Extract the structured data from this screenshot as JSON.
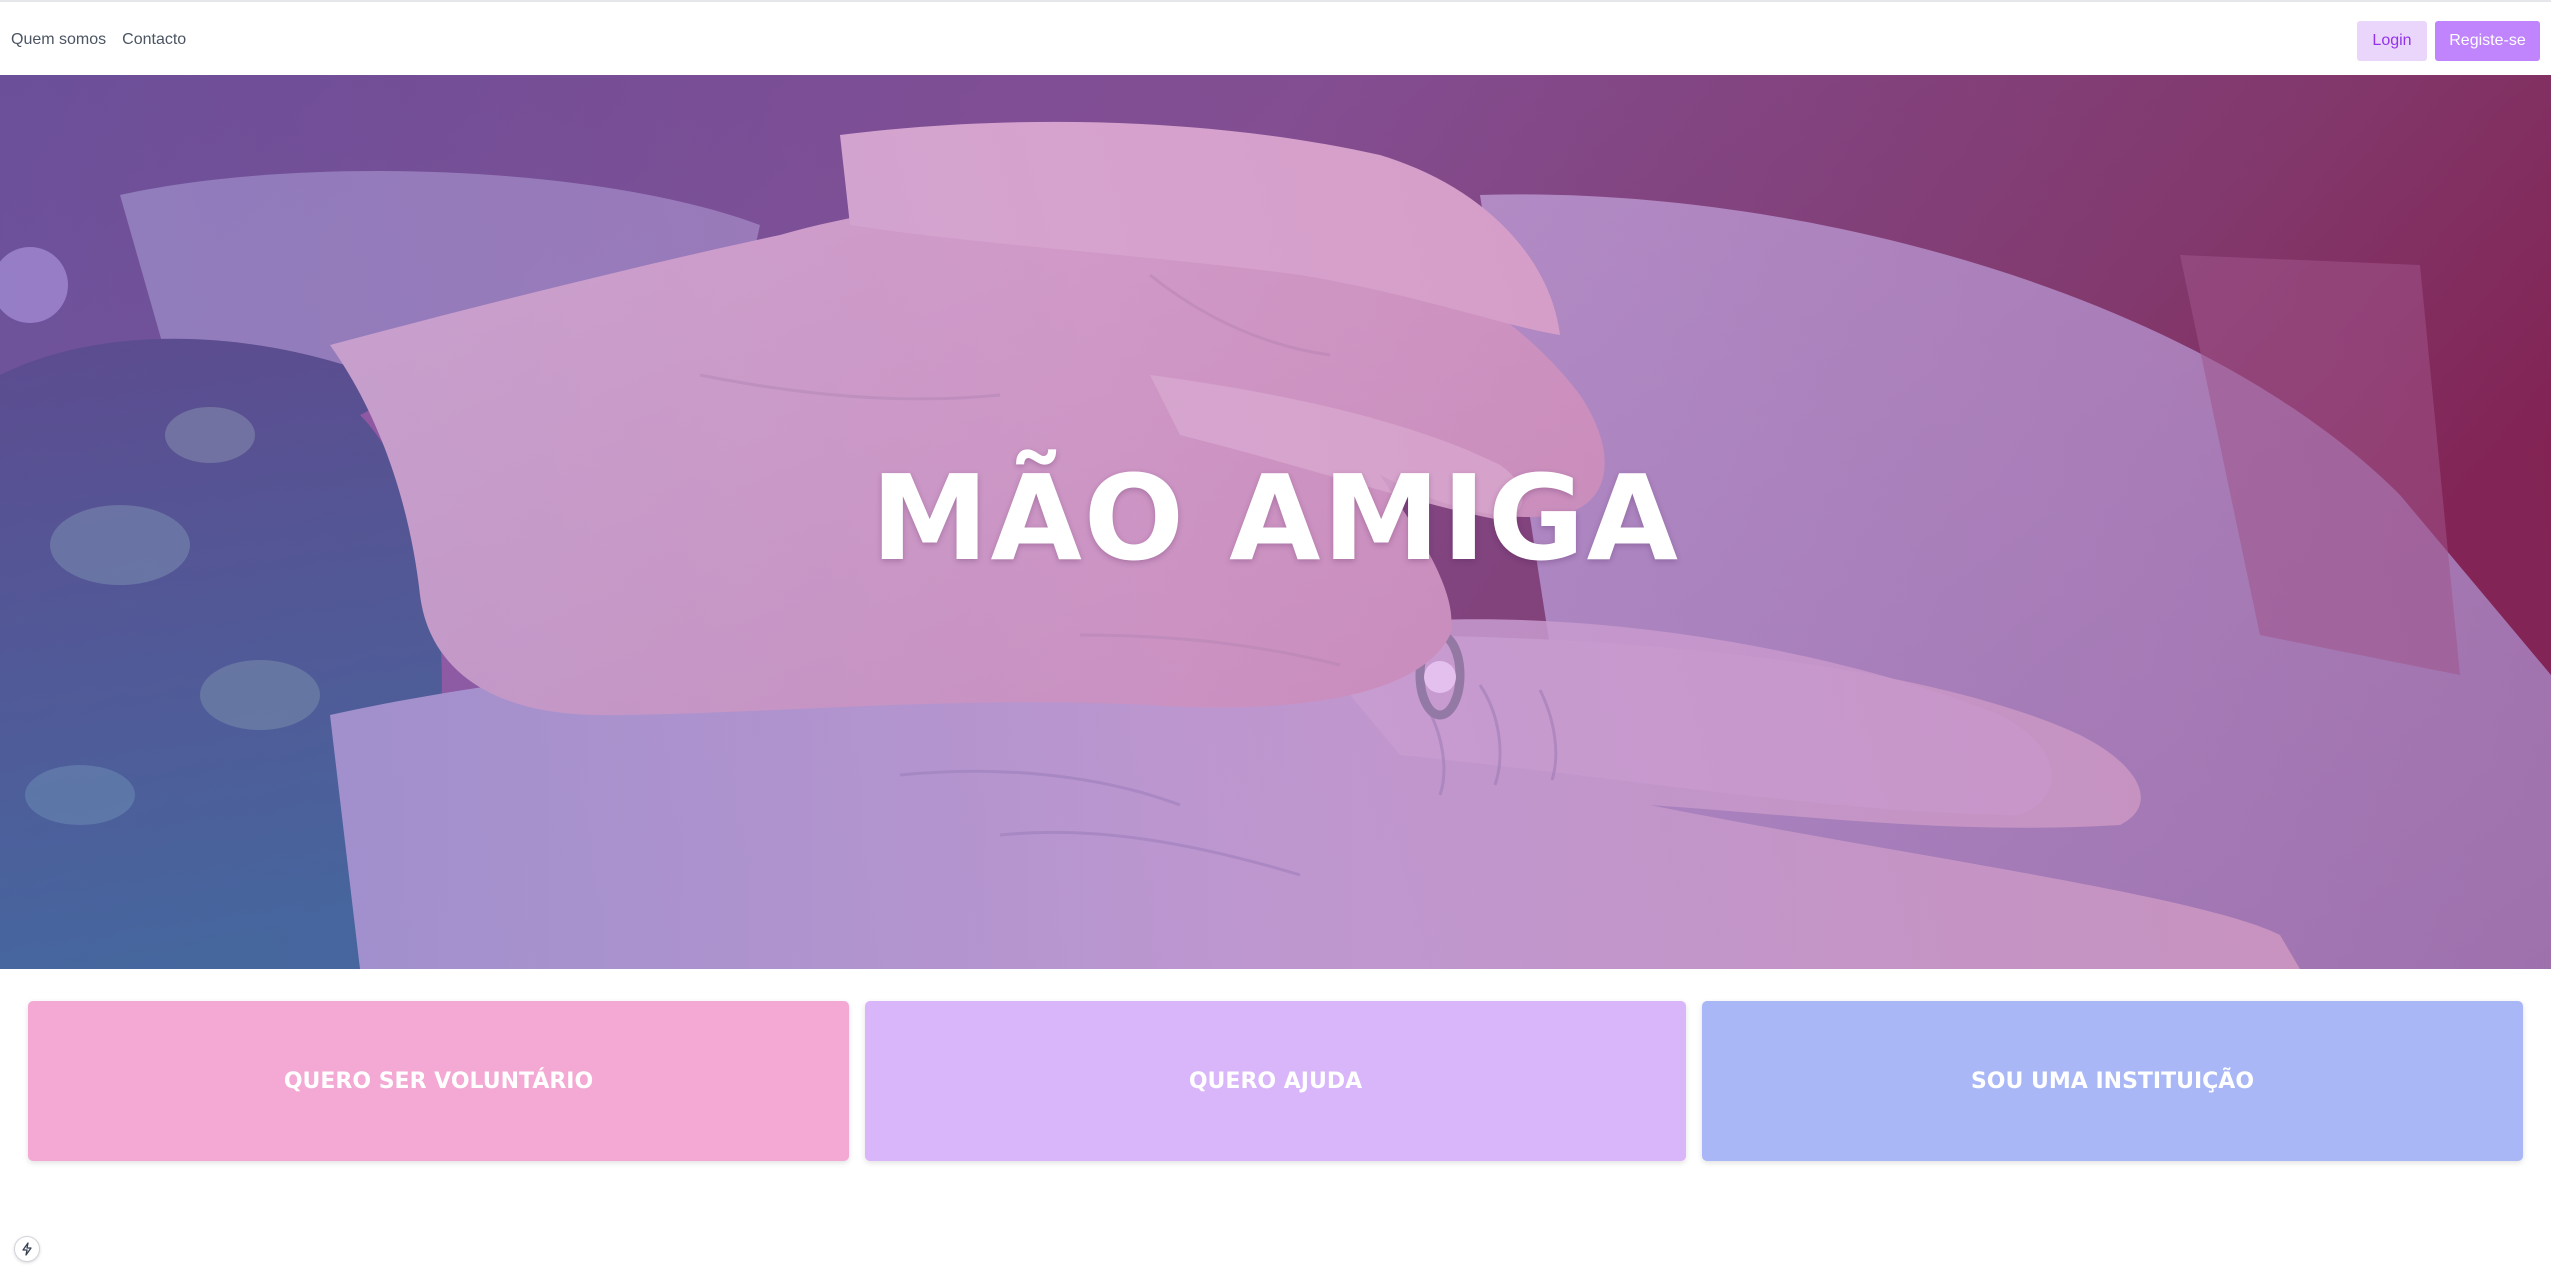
{
  "nav": {
    "links": [
      {
        "label": "Quem somos"
      },
      {
        "label": "Contacto"
      }
    ],
    "login_label": "Login",
    "register_label": "Registe-se"
  },
  "hero": {
    "title": "MÃO AMIGA",
    "image_icon": "holding-hands-photo"
  },
  "cards": [
    {
      "label": "QUERO SER VOLUNTÁRIO",
      "color": "#f3a9d3"
    },
    {
      "label": "QUERO AJUDA",
      "color": "#d9b6fa"
    },
    {
      "label": "SOU UMA INSTITUIÇÃO",
      "color": "#a9b7f7"
    }
  ],
  "widget": {
    "icon": "lightning-icon"
  },
  "colors": {
    "accent": "#c084fc",
    "accent_light": "#ead6fb"
  }
}
